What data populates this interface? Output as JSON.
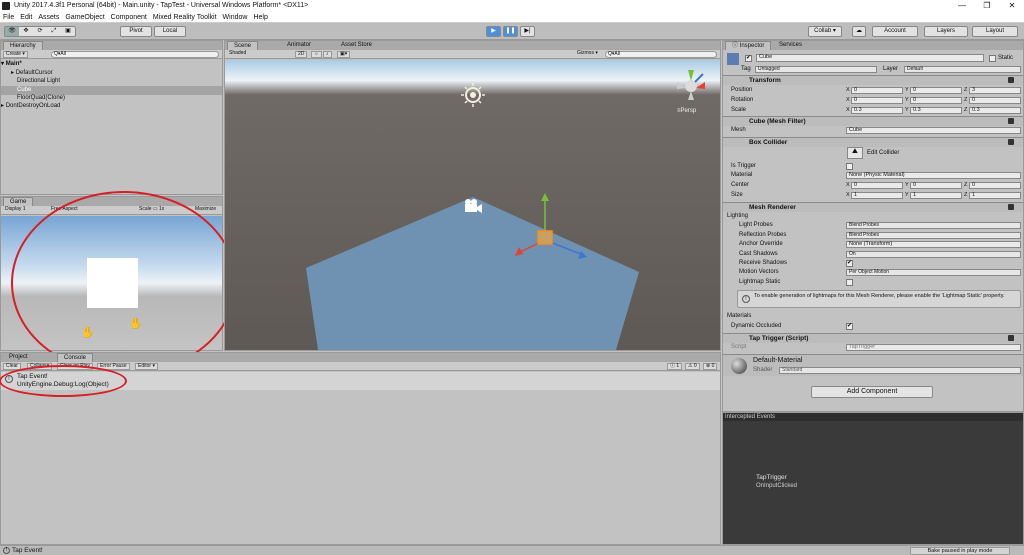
{
  "title": "Unity 2017.4.3f1 Personal (64bit) - Main.unity - TapTest - Universal Windows Platform* <DX11>",
  "menu": [
    "File",
    "Edit",
    "Assets",
    "GameObject",
    "Component",
    "Mixed Reality Toolkit",
    "Window",
    "Help"
  ],
  "toolbar": {
    "pivot": "Pivot",
    "local": "Local",
    "collab": "Collab ▾",
    "account": "Account",
    "layers": "Layers",
    "layout": "Layout"
  },
  "hierarchy": {
    "tab": "Hierarchy",
    "create": "Create ▾",
    "search": "Q▾All",
    "scene": "Main*",
    "items": [
      "DefaultCursor",
      "Directional Light",
      "Cube",
      "FloorQuad(Clone)",
      "DontDestroyOnLoad"
    ]
  },
  "scene": {
    "tabs": [
      "Scene",
      "Animator",
      "Asset Store"
    ],
    "shaded": "Shaded",
    "twod": "2D",
    "gizmos": "Gizmos ▾",
    "search": "Q▾All",
    "persp": "≡Persp"
  },
  "game": {
    "tab": "Game",
    "display": "Display 1",
    "aspect": "Free Aspect",
    "scale": "Scale",
    "scale_val": "1x",
    "maximize": "Maximize"
  },
  "console": {
    "tabs": [
      "Project",
      "Console"
    ],
    "buttons": [
      "Clear",
      "Collapse",
      "Clear on Play",
      "Error Pause",
      "Editor ▾"
    ],
    "counts": [
      "1",
      "0",
      "0"
    ],
    "log_line1": "Tap Event!",
    "log_line2": "UnityEngine.Debug:Log(Object)"
  },
  "inspector": {
    "tabs": [
      "Inspector",
      "Services"
    ],
    "name": "Cube",
    "static": "Static",
    "tag_label": "Tag",
    "tag": "Untagged",
    "layer_label": "Layer",
    "layer": "Default",
    "transform": {
      "title": "Transform",
      "rows": [
        {
          "label": "Position",
          "x": "0",
          "y": "0",
          "z": "3"
        },
        {
          "label": "Rotation",
          "x": "0",
          "y": "0",
          "z": "0"
        },
        {
          "label": "Scale",
          "x": "0.3",
          "y": "0.3",
          "z": "0.3"
        }
      ]
    },
    "mesh_filter": {
      "title": "Cube (Mesh Filter)",
      "mesh_label": "Mesh",
      "mesh": "Cube"
    },
    "box_collider": {
      "title": "Box Collider",
      "edit": "Edit Collider",
      "is_trigger": "Is Trigger",
      "material": "Material",
      "material_val": "None (Physic Material)",
      "center": "Center",
      "center_vals": [
        "0",
        "0",
        "0"
      ],
      "size": "Size",
      "size_vals": [
        "1",
        "1",
        "1"
      ]
    },
    "mesh_renderer": {
      "title": "Mesh Renderer",
      "lighting": "Lighting",
      "light_probes": "Light Probes",
      "light_probes_val": "Blend Probes",
      "reflection": "Reflection Probes",
      "reflection_val": "Blend Probes",
      "anchor": "Anchor Override",
      "anchor_val": "None (Transform)",
      "cast": "Cast Shadows",
      "cast_val": "On",
      "receive": "Receive Shadows",
      "motion": "Motion Vectors",
      "motion_val": "Per Object Motion",
      "lightmap": "Lightmap Static",
      "info": "To enable generation of lightmaps for this Mesh Renderer, please enable the 'Lightmap Static' property.",
      "materials": "Materials",
      "dyn_occ": "Dynamic Occluded"
    },
    "tap_trigger": {
      "title": "Tap Trigger (Script)",
      "script_label": "Script",
      "script": "TapTrigger"
    },
    "material": {
      "name": "Default-Material",
      "shader_label": "Shader",
      "shader": "Standard"
    },
    "add_component": "Add Component"
  },
  "intercepted": {
    "title": "Intercepted Events",
    "trigger": "TapTrigger",
    "event": "OnInputClicked"
  },
  "status": {
    "msg": "Tap Event!",
    "bake": "Bake paused in play mode"
  }
}
